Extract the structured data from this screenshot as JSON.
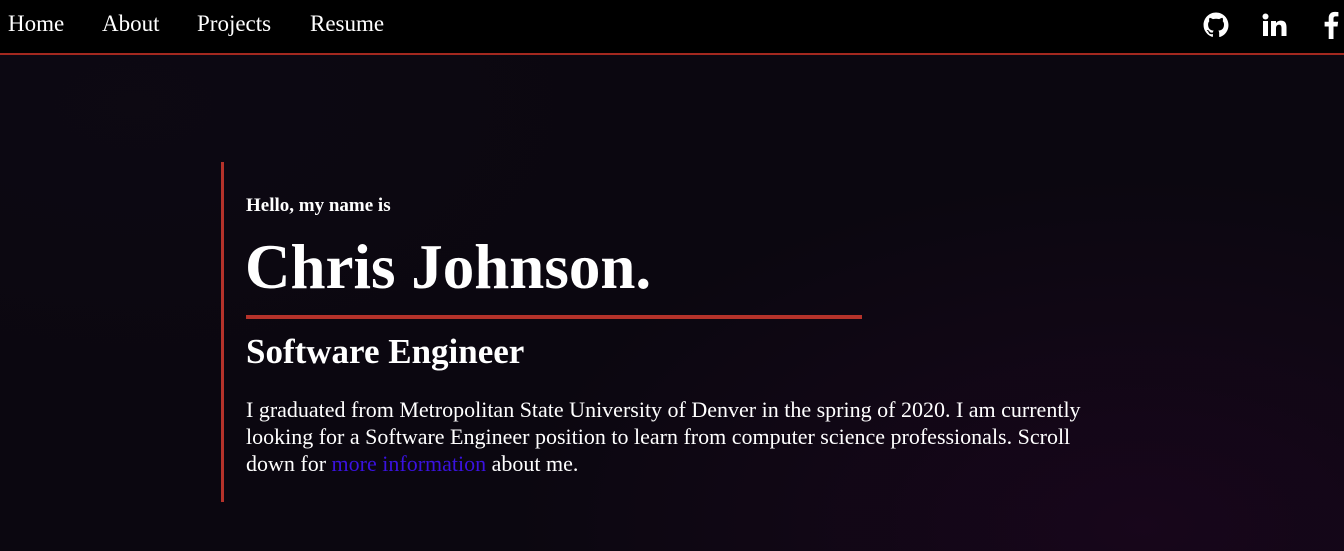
{
  "nav": {
    "links": [
      {
        "label": "Home"
      },
      {
        "label": "About"
      },
      {
        "label": "Projects"
      },
      {
        "label": "Resume"
      }
    ],
    "social": [
      {
        "icon": "github-icon"
      },
      {
        "icon": "linkedin-icon"
      },
      {
        "icon": "facebook-icon"
      }
    ]
  },
  "hero": {
    "greeting": "Hello, my name is",
    "name": "Chris Johnson.",
    "role": "Software Engineer",
    "bio_before": "I graduated from Metropolitan State University of Denver in the spring of 2020. I am currently looking for a Software Engineer position to learn from computer science professionals. Scroll down for ",
    "bio_link": "more information",
    "bio_after": " about me."
  },
  "colors": {
    "accent": "#b5322a",
    "link": "#3a12e0",
    "navbar_bg": "#000000",
    "page_bg": "#0b0710"
  }
}
